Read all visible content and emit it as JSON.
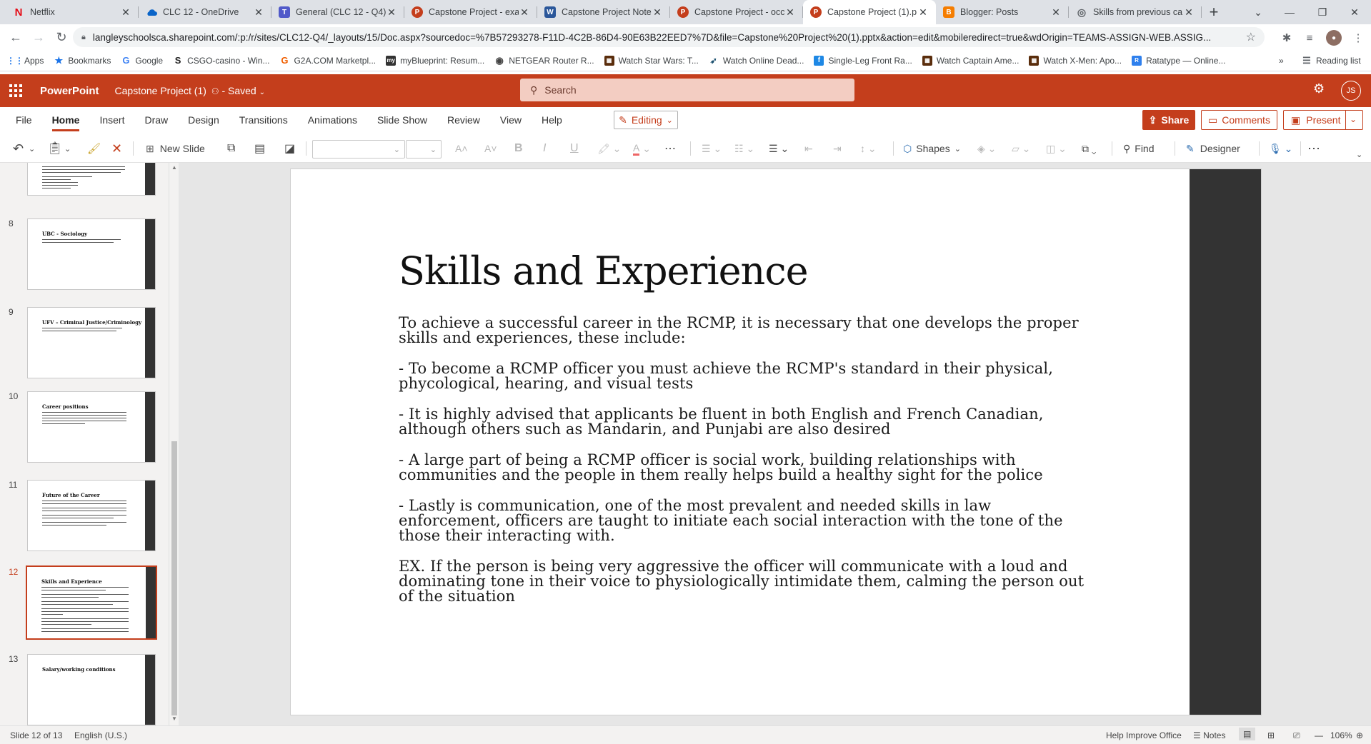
{
  "browser": {
    "tabs": [
      {
        "title": "Netflix",
        "icon": "netflix-icon",
        "color": "#e50914",
        "glyph": "N",
        "active": false
      },
      {
        "title": "CLC 12 - OneDrive",
        "icon": "onedrive-icon",
        "color": "#0a64c8",
        "glyph": "",
        "active": false
      },
      {
        "title": "General (CLC 12 - Q4)",
        "icon": "teams-icon",
        "color": "#5059c9",
        "glyph": "T",
        "active": false
      },
      {
        "title": "Capstone Project - exa",
        "icon": "powerpoint-icon",
        "color": "#c43e1c",
        "glyph": "P",
        "active": false
      },
      {
        "title": "Capstone Project Note",
        "icon": "word-icon",
        "color": "#2b579a",
        "glyph": "W",
        "active": false
      },
      {
        "title": "Capstone Project - occ",
        "icon": "powerpoint-icon",
        "color": "#c43e1c",
        "glyph": "P",
        "active": false
      },
      {
        "title": "Capstone Project (1).p",
        "icon": "powerpoint-icon",
        "color": "#c43e1c",
        "glyph": "P",
        "active": true
      },
      {
        "title": "Blogger: Posts",
        "icon": "blogger-icon",
        "color": "#f57d00",
        "glyph": "B",
        "active": false
      },
      {
        "title": "Skills from previous ca",
        "icon": "globe-icon",
        "color": "#5f6368",
        "glyph": "",
        "active": false
      }
    ],
    "url": "langleyschoolsca.sharepoint.com/:p:/r/sites/CLC12-Q4/_layouts/15/Doc.aspx?sourcedoc=%7B57293278-F11D-4C2B-86D4-90E63B22EED7%7D&file=Capstone%20Project%20(1).pptx&action=edit&mobileredirect=true&wdOrigin=TEAMS-ASSIGN-WEB.ASSIG...",
    "bookmarks": [
      {
        "label": "Apps",
        "icon": "apps-grid-icon",
        "color": "#5f6368"
      },
      {
        "label": "Bookmarks",
        "icon": "star-icon",
        "color": "#1a73e8"
      },
      {
        "label": "Google",
        "icon": "google-icon",
        "color": "#4285f4"
      },
      {
        "label": "CSGO-casino - Win...",
        "icon": "csgo-icon",
        "color": "#222222"
      },
      {
        "label": "G2A.COM Marketpl...",
        "icon": "g2a-icon",
        "color": "#f05f00"
      },
      {
        "label": "myBlueprint: Resum...",
        "icon": "myblueprint-icon",
        "color": "#333333"
      },
      {
        "label": "NETGEAR Router R...",
        "icon": "netgear-icon",
        "color": "#444444"
      },
      {
        "label": "Watch Star Wars: T...",
        "icon": "film-icon",
        "color": "#5a2d0c"
      },
      {
        "label": "Watch Online Dead...",
        "icon": "bird-icon",
        "color": "#1a4f6e"
      },
      {
        "label": "Single-Leg Front Ra...",
        "icon": "fitness-icon",
        "color": "#1e88e5"
      },
      {
        "label": "Watch Captain Ame...",
        "icon": "film-icon",
        "color": "#5a2d0c"
      },
      {
        "label": "Watch X-Men: Apo...",
        "icon": "film-icon",
        "color": "#5a2d0c"
      },
      {
        "label": "Ratatype — Online...",
        "icon": "ratatype-icon",
        "color": "#2f80ed"
      }
    ],
    "more_bookmarks": "»",
    "reading_list": "Reading list"
  },
  "app": {
    "name": "PowerPoint",
    "doc_title": "Capstone Project (1)",
    "saved_status": "- Saved",
    "search_placeholder": "Search",
    "avatar_initials": "JS",
    "accent": "#c43e1c"
  },
  "ribbon": {
    "tabs": [
      "File",
      "Home",
      "Insert",
      "Draw",
      "Design",
      "Transitions",
      "Animations",
      "Slide Show",
      "Review",
      "View",
      "Help"
    ],
    "active_tab": "Home",
    "editing_label": "Editing",
    "share_label": "Share",
    "comments_label": "Comments",
    "present_label": "Present",
    "new_slide_label": "New Slide",
    "shapes_label": "Shapes",
    "find_label": "Find",
    "designer_label": "Designer"
  },
  "thumbnails": [
    {
      "num": "",
      "title": ""
    },
    {
      "num": "8",
      "title": "UBC - Sociology"
    },
    {
      "num": "9",
      "title": "UFV – Criminal Justice/Criminology"
    },
    {
      "num": "10",
      "title": "Career positions"
    },
    {
      "num": "11",
      "title": "Future of the Career"
    },
    {
      "num": "12",
      "title": "Skills and Experience"
    },
    {
      "num": "13",
      "title": "Salary/working conditions"
    }
  ],
  "selected_slide": "12",
  "slide": {
    "title": "Skills and Experience",
    "paragraphs": [
      "To achieve a successful career in the RCMP, it is necessary that one develops the proper skills and experiences, these include:",
      "- To become a RCMP officer you must achieve the RCMP's standard in their physical, phycological, hearing, and visual tests",
      "- It is highly advised that applicants be fluent in both English and French Canadian, although others such as Mandarin, and Punjabi are also desired",
      "- A large part of being a RCMP officer is social work, building relationships with communities and the people in them really helps build a healthy sight for the police",
      "- Lastly is communication, one of the most prevalent and needed skills in law enforcement, officers are taught to initiate each social interaction with the tone of the those their interacting with.",
      "EX. If the person is being very aggressive the officer will communicate with a loud and dominating tone in their voice to physiologically intimidate them, calming the person out of the situation"
    ]
  },
  "status": {
    "slide_counter": "Slide 12 of 13",
    "language": "English (U.S.)",
    "help_improve": "Help Improve Office",
    "notes": "Notes",
    "zoom": "106%"
  }
}
